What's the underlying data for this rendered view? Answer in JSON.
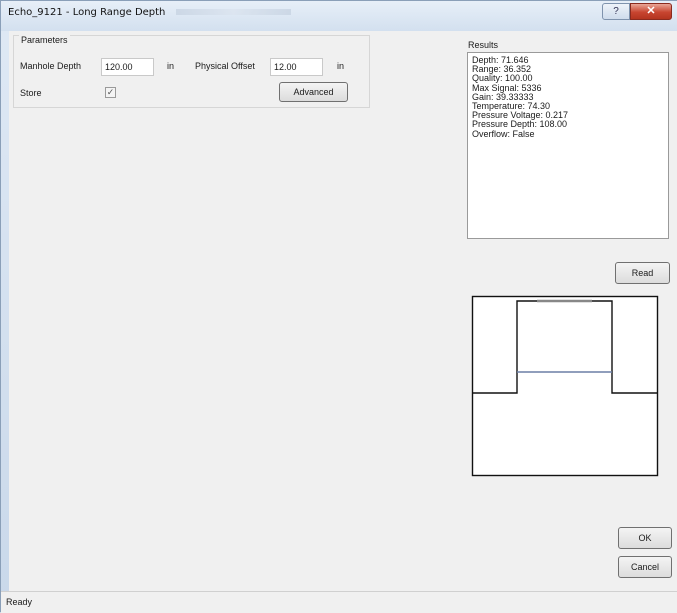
{
  "window": {
    "title": "Echo_9121 - Long Range Depth",
    "help_glyph": "?",
    "close_glyph": "✕"
  },
  "parameters": {
    "group_label": "Parameters",
    "manhole_depth_label": "Manhole Depth",
    "manhole_depth_value": "120.00",
    "manhole_depth_unit": "in",
    "physical_offset_label": "Physical Offset",
    "physical_offset_value": "12.00",
    "physical_offset_unit": "in",
    "store_label": "Store",
    "store_checked": true,
    "store_check_glyph": "✓",
    "advanced_button": "Advanced"
  },
  "results": {
    "label": "Results",
    "lines": [
      "Depth: 71.646",
      "Range: 36.352",
      "Quality: 100.00",
      "Max Signal: 5336",
      "Gain: 39.33333",
      "Temperature: 74.30",
      "Pressure Voltage: 0.217",
      "Pressure Depth: 108.00",
      "Overflow: False"
    ]
  },
  "buttons": {
    "read": "Read",
    "ok": "OK",
    "cancel": "Cancel"
  },
  "status": {
    "text": "Ready"
  },
  "colors": {
    "window_chrome": "#cfdcea",
    "client_bg": "#f0f0f0",
    "close_red": "#c84530",
    "water_line": "#6b7fa6"
  }
}
